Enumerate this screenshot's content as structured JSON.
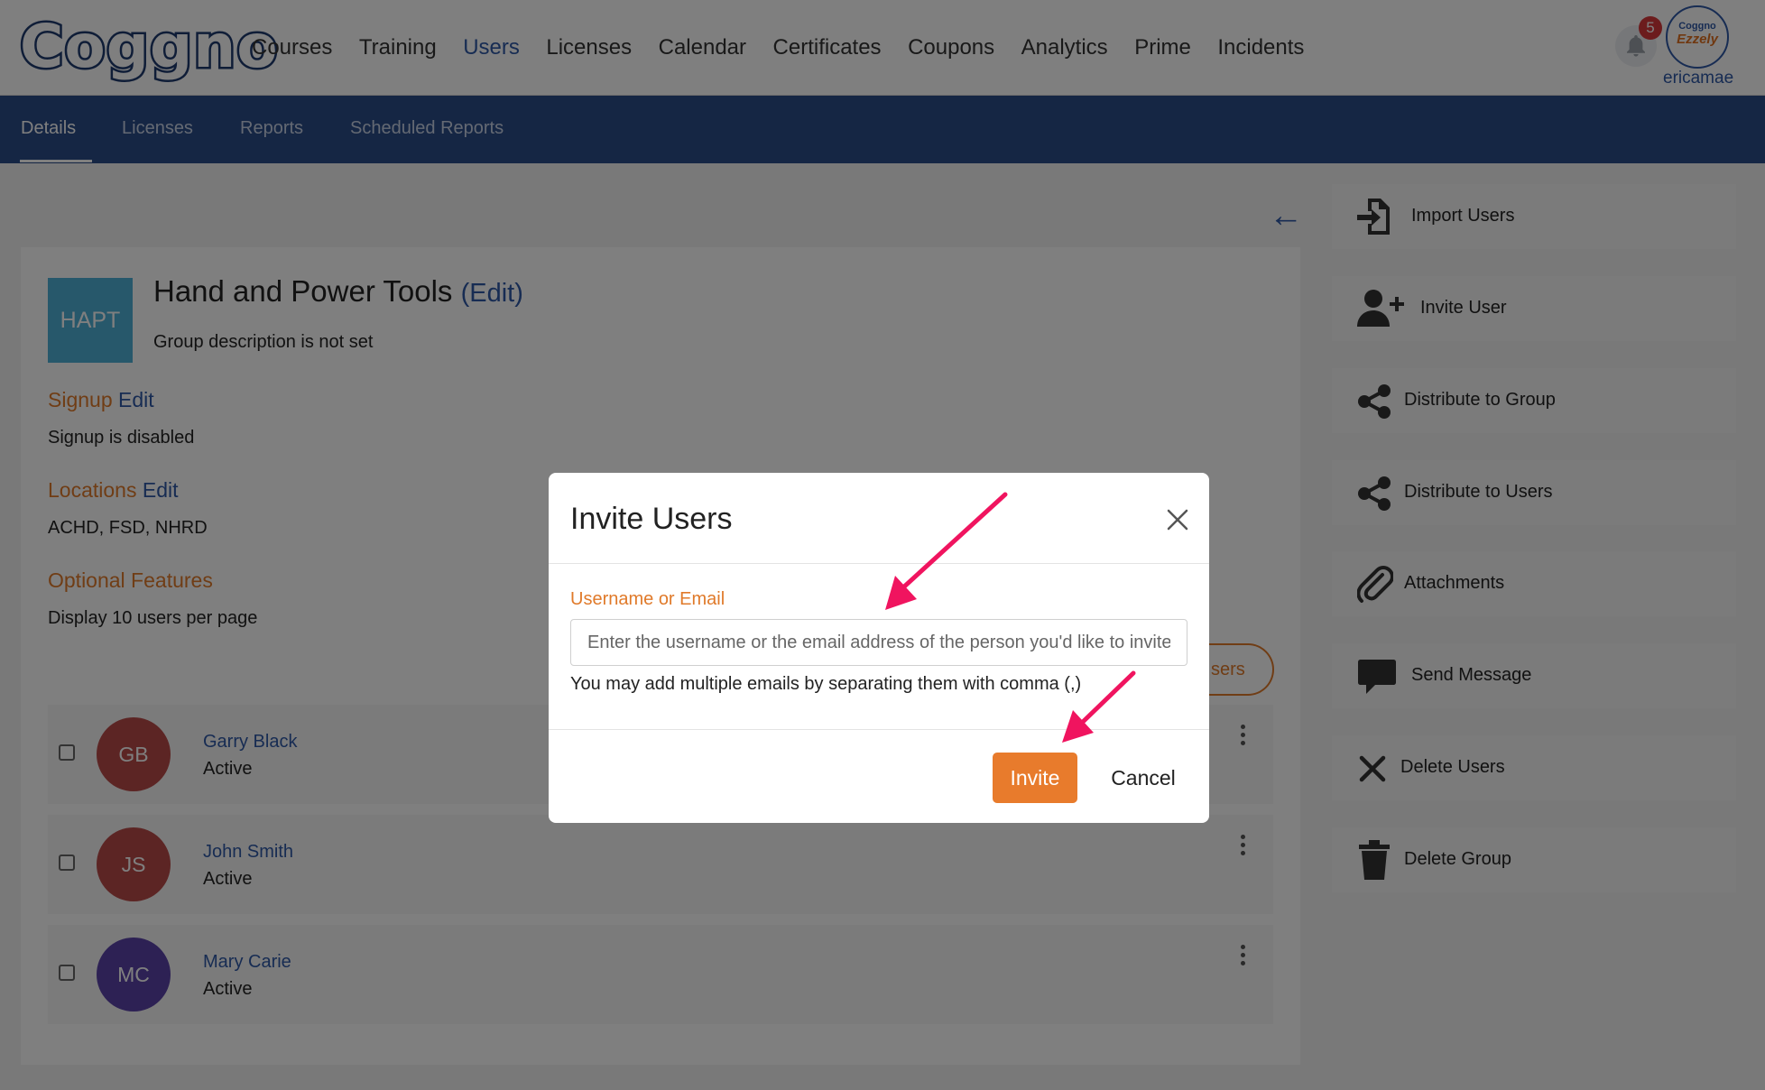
{
  "brand": {
    "logo_text": "Coggno"
  },
  "nav": {
    "items": [
      {
        "label": "Courses",
        "active": false
      },
      {
        "label": "Training",
        "active": false
      },
      {
        "label": "Users",
        "active": true
      },
      {
        "label": "Licenses",
        "active": false
      },
      {
        "label": "Calendar",
        "active": false
      },
      {
        "label": "Certificates",
        "active": false
      },
      {
        "label": "Coupons",
        "active": false
      },
      {
        "label": "Analytics",
        "active": false
      },
      {
        "label": "Prime",
        "active": false
      },
      {
        "label": "Incidents",
        "active": false
      }
    ]
  },
  "notifications": {
    "count": "5",
    "icon": "bell-icon"
  },
  "account": {
    "avatar_line1": "Coggno",
    "avatar_line2": "Ezzely",
    "username": "ericamae"
  },
  "subnav": {
    "tabs": [
      {
        "label": "Details",
        "active": true
      },
      {
        "label": "Licenses",
        "active": false
      },
      {
        "label": "Reports",
        "active": false
      },
      {
        "label": "Scheduled Reports",
        "active": false
      }
    ]
  },
  "back_icon": "arrow-left-icon",
  "group": {
    "initials": "HAPT",
    "name": "Hand and Power Tools",
    "edit_label": "(Edit)",
    "description": "Group description is not set",
    "signup_title": "Signup",
    "signup_edit": "Edit",
    "signup_status": "Signup is disabled",
    "locations_title": "Locations",
    "locations_edit": "Edit",
    "locations_value": "ACHD, FSD, NHRD",
    "optional_title": "Optional Features",
    "optional_value": "Display 10 users per page",
    "partial_button": "sers"
  },
  "users": [
    {
      "initials": "GB",
      "name": "Garry Black",
      "status": "Active",
      "color": "#b94a48"
    },
    {
      "initials": "JS",
      "name": "John Smith",
      "status": "Active",
      "color": "#b94a48"
    },
    {
      "initials": "MC",
      "name": "Mary Carie",
      "status": "Active",
      "color": "#5a43a8"
    }
  ],
  "sidebar": {
    "items": [
      {
        "label": "Import Users",
        "icon": "file-import-icon"
      },
      {
        "label": "Invite User",
        "icon": "user-plus-icon"
      },
      {
        "label": "Distribute to Group",
        "icon": "share-icon"
      },
      {
        "label": "Distribute to Users",
        "icon": "share-icon"
      },
      {
        "label": "Attachments",
        "icon": "paperclip-icon"
      },
      {
        "label": "Send Message",
        "icon": "message-icon"
      },
      {
        "label": "Delete Users",
        "icon": "x-icon"
      },
      {
        "label": "Delete Group",
        "icon": "trash-icon"
      }
    ]
  },
  "modal": {
    "title": "Invite Users",
    "field_label": "Username or Email",
    "field_value": "",
    "field_placeholder": "Enter the username or the email address of the person you'd like to invite",
    "help_text": "You may add multiple emails by separating them with comma (,)",
    "invite_label": "Invite",
    "cancel_label": "Cancel",
    "close_icon": "close-icon"
  },
  "colors": {
    "brand_blue": "#2b4d89",
    "accent_orange": "#e87b2c",
    "annotation_arrow": "#f0145f"
  }
}
